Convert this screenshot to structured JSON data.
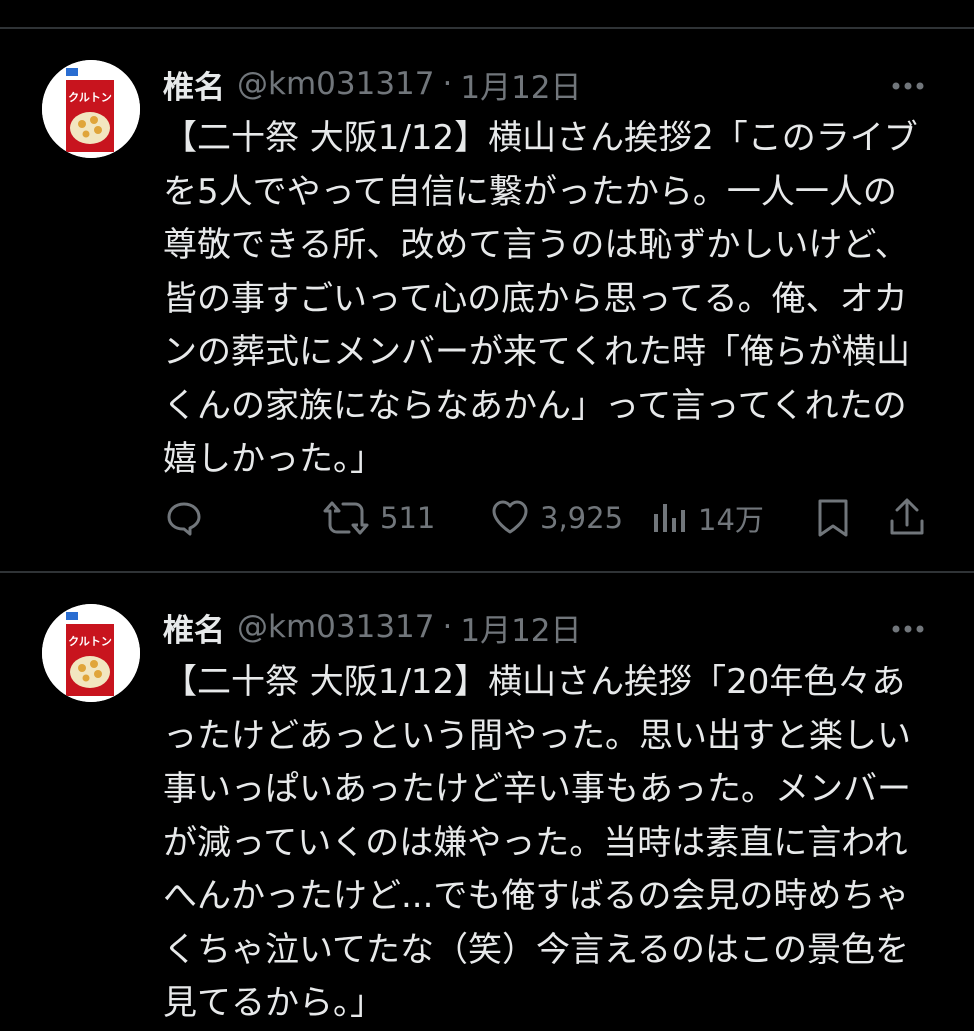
{
  "tweets": [
    {
      "name": "椎名",
      "handle": "@km031317",
      "separator": "·",
      "date": "1月12日",
      "text": "【二十祭 大阪1/12】横山さん挨拶2「このライブ\nを5人でやって自信に繋がったから。一人一人の\n尊敬できる所、改めて言うのは恥ずかしいけど、\n皆の事すごいって心の底から思ってる。俺、オカ\nンの葬式にメンバーが来てくれた時「俺らが横山\nくんの家族にならなあかん」って言ってくれたの\n嬉しかった。」",
      "retweets": "511",
      "likes": "3,925",
      "views": "14万",
      "avatar_text": "クルトン"
    },
    {
      "name": "椎名",
      "handle": "@km031317",
      "separator": "·",
      "date": "1月12日",
      "text": "【二十祭 大阪1/12】横山さん挨拶「20年色々あ\nったけどあっという間やった。思い出すと楽しい\n事いっぱいあったけど辛い事もあった。メンバー\nが減っていくのは嫌やった。当時は素直に言われ\nへんかったけど...でも俺すばるの会見の時めちゃ\nくちゃ泣いてたな（笑）今言えるのはこの景色を\n見てるから。」",
      "avatar_text": "クルトン"
    }
  ],
  "colors": {
    "background": "#000000",
    "text": "#e7e9ea",
    "secondary": "#71767b",
    "divider": "#2f3336"
  }
}
